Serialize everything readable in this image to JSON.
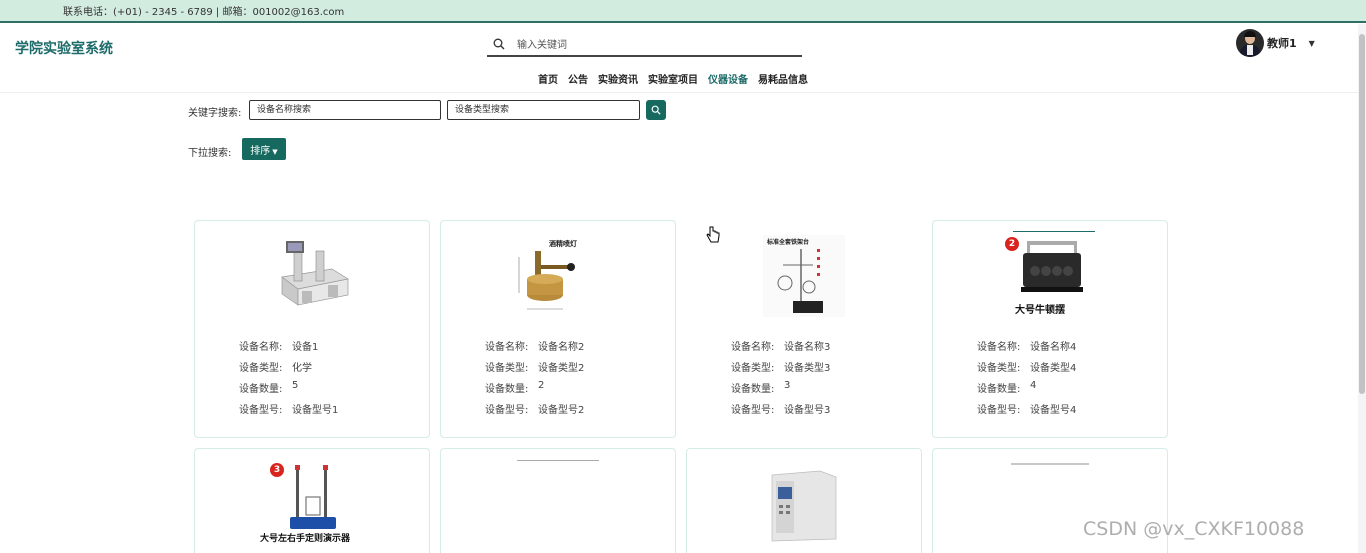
{
  "topbar": {
    "contact": "联系电话：(+01) - 2345 - 6789 | 邮箱：001002@163.com"
  },
  "header": {
    "site_title": "学院实验室系统",
    "search_placeholder": "输入关键词",
    "user_name": "教师1"
  },
  "nav": [
    {
      "label": "首页",
      "active": false
    },
    {
      "label": "公告",
      "active": false
    },
    {
      "label": "实验资讯",
      "active": false
    },
    {
      "label": "实验室项目",
      "active": false
    },
    {
      "label": "仪器设备",
      "active": true
    },
    {
      "label": "易耗品信息",
      "active": false
    }
  ],
  "filters": {
    "keyword_label": "关键字搜索:",
    "name_placeholder": "设备名称搜索",
    "type_placeholder": "设备类型搜索",
    "dropdown_label": "下拉搜索:",
    "sort_label": "排序"
  },
  "field_labels": {
    "name": "设备名称:",
    "type": "设备类型:",
    "count": "设备数量:",
    "model": "设备型号:"
  },
  "devices": [
    {
      "name": "设备1",
      "type": "化学",
      "count": "5",
      "model": "设备型号1"
    },
    {
      "name": "设备名称2",
      "type": "设备类型2",
      "count": "2",
      "model": "设备型号2",
      "img_caption": "酒精喷灯"
    },
    {
      "name": "设备名称3",
      "type": "设备类型3",
      "count": "3",
      "model": "设备型号3",
      "img_caption": "标准全套铁架台"
    },
    {
      "name": "设备名称4",
      "type": "设备类型4",
      "count": "4",
      "model": "设备型号4",
      "img_caption": "大号牛顿摆",
      "img_badge": "2"
    },
    {
      "img_caption": "大号左右手定则演示器",
      "img_badge": "3"
    }
  ],
  "watermark": "CSDN @vx_CXKF10088",
  "colors": {
    "brand": "#1d6b6a",
    "button": "#16695f",
    "topbar": "#d3ece0"
  }
}
